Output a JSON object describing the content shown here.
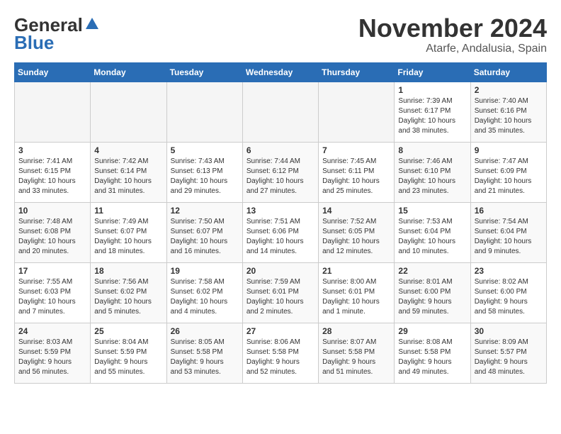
{
  "logo": {
    "general": "General",
    "blue": "Blue"
  },
  "title": "November 2024",
  "location": "Atarfe, Andalusia, Spain",
  "days_header": [
    "Sunday",
    "Monday",
    "Tuesday",
    "Wednesday",
    "Thursday",
    "Friday",
    "Saturday"
  ],
  "weeks": [
    [
      {
        "day": "",
        "content": ""
      },
      {
        "day": "",
        "content": ""
      },
      {
        "day": "",
        "content": ""
      },
      {
        "day": "",
        "content": ""
      },
      {
        "day": "",
        "content": ""
      },
      {
        "day": "1",
        "content": "Sunrise: 7:39 AM\nSunset: 6:17 PM\nDaylight: 10 hours\nand 38 minutes."
      },
      {
        "day": "2",
        "content": "Sunrise: 7:40 AM\nSunset: 6:16 PM\nDaylight: 10 hours\nand 35 minutes."
      }
    ],
    [
      {
        "day": "3",
        "content": "Sunrise: 7:41 AM\nSunset: 6:15 PM\nDaylight: 10 hours\nand 33 minutes."
      },
      {
        "day": "4",
        "content": "Sunrise: 7:42 AM\nSunset: 6:14 PM\nDaylight: 10 hours\nand 31 minutes."
      },
      {
        "day": "5",
        "content": "Sunrise: 7:43 AM\nSunset: 6:13 PM\nDaylight: 10 hours\nand 29 minutes."
      },
      {
        "day": "6",
        "content": "Sunrise: 7:44 AM\nSunset: 6:12 PM\nDaylight: 10 hours\nand 27 minutes."
      },
      {
        "day": "7",
        "content": "Sunrise: 7:45 AM\nSunset: 6:11 PM\nDaylight: 10 hours\nand 25 minutes."
      },
      {
        "day": "8",
        "content": "Sunrise: 7:46 AM\nSunset: 6:10 PM\nDaylight: 10 hours\nand 23 minutes."
      },
      {
        "day": "9",
        "content": "Sunrise: 7:47 AM\nSunset: 6:09 PM\nDaylight: 10 hours\nand 21 minutes."
      }
    ],
    [
      {
        "day": "10",
        "content": "Sunrise: 7:48 AM\nSunset: 6:08 PM\nDaylight: 10 hours\nand 20 minutes."
      },
      {
        "day": "11",
        "content": "Sunrise: 7:49 AM\nSunset: 6:07 PM\nDaylight: 10 hours\nand 18 minutes."
      },
      {
        "day": "12",
        "content": "Sunrise: 7:50 AM\nSunset: 6:07 PM\nDaylight: 10 hours\nand 16 minutes."
      },
      {
        "day": "13",
        "content": "Sunrise: 7:51 AM\nSunset: 6:06 PM\nDaylight: 10 hours\nand 14 minutes."
      },
      {
        "day": "14",
        "content": "Sunrise: 7:52 AM\nSunset: 6:05 PM\nDaylight: 10 hours\nand 12 minutes."
      },
      {
        "day": "15",
        "content": "Sunrise: 7:53 AM\nSunset: 6:04 PM\nDaylight: 10 hours\nand 10 minutes."
      },
      {
        "day": "16",
        "content": "Sunrise: 7:54 AM\nSunset: 6:04 PM\nDaylight: 10 hours\nand 9 minutes."
      }
    ],
    [
      {
        "day": "17",
        "content": "Sunrise: 7:55 AM\nSunset: 6:03 PM\nDaylight: 10 hours\nand 7 minutes."
      },
      {
        "day": "18",
        "content": "Sunrise: 7:56 AM\nSunset: 6:02 PM\nDaylight: 10 hours\nand 5 minutes."
      },
      {
        "day": "19",
        "content": "Sunrise: 7:58 AM\nSunset: 6:02 PM\nDaylight: 10 hours\nand 4 minutes."
      },
      {
        "day": "20",
        "content": "Sunrise: 7:59 AM\nSunset: 6:01 PM\nDaylight: 10 hours\nand 2 minutes."
      },
      {
        "day": "21",
        "content": "Sunrise: 8:00 AM\nSunset: 6:01 PM\nDaylight: 10 hours\nand 1 minute."
      },
      {
        "day": "22",
        "content": "Sunrise: 8:01 AM\nSunset: 6:00 PM\nDaylight: 9 hours\nand 59 minutes."
      },
      {
        "day": "23",
        "content": "Sunrise: 8:02 AM\nSunset: 6:00 PM\nDaylight: 9 hours\nand 58 minutes."
      }
    ],
    [
      {
        "day": "24",
        "content": "Sunrise: 8:03 AM\nSunset: 5:59 PM\nDaylight: 9 hours\nand 56 minutes."
      },
      {
        "day": "25",
        "content": "Sunrise: 8:04 AM\nSunset: 5:59 PM\nDaylight: 9 hours\nand 55 minutes."
      },
      {
        "day": "26",
        "content": "Sunrise: 8:05 AM\nSunset: 5:58 PM\nDaylight: 9 hours\nand 53 minutes."
      },
      {
        "day": "27",
        "content": "Sunrise: 8:06 AM\nSunset: 5:58 PM\nDaylight: 9 hours\nand 52 minutes."
      },
      {
        "day": "28",
        "content": "Sunrise: 8:07 AM\nSunset: 5:58 PM\nDaylight: 9 hours\nand 51 minutes."
      },
      {
        "day": "29",
        "content": "Sunrise: 8:08 AM\nSunset: 5:58 PM\nDaylight: 9 hours\nand 49 minutes."
      },
      {
        "day": "30",
        "content": "Sunrise: 8:09 AM\nSunset: 5:57 PM\nDaylight: 9 hours\nand 48 minutes."
      }
    ]
  ]
}
